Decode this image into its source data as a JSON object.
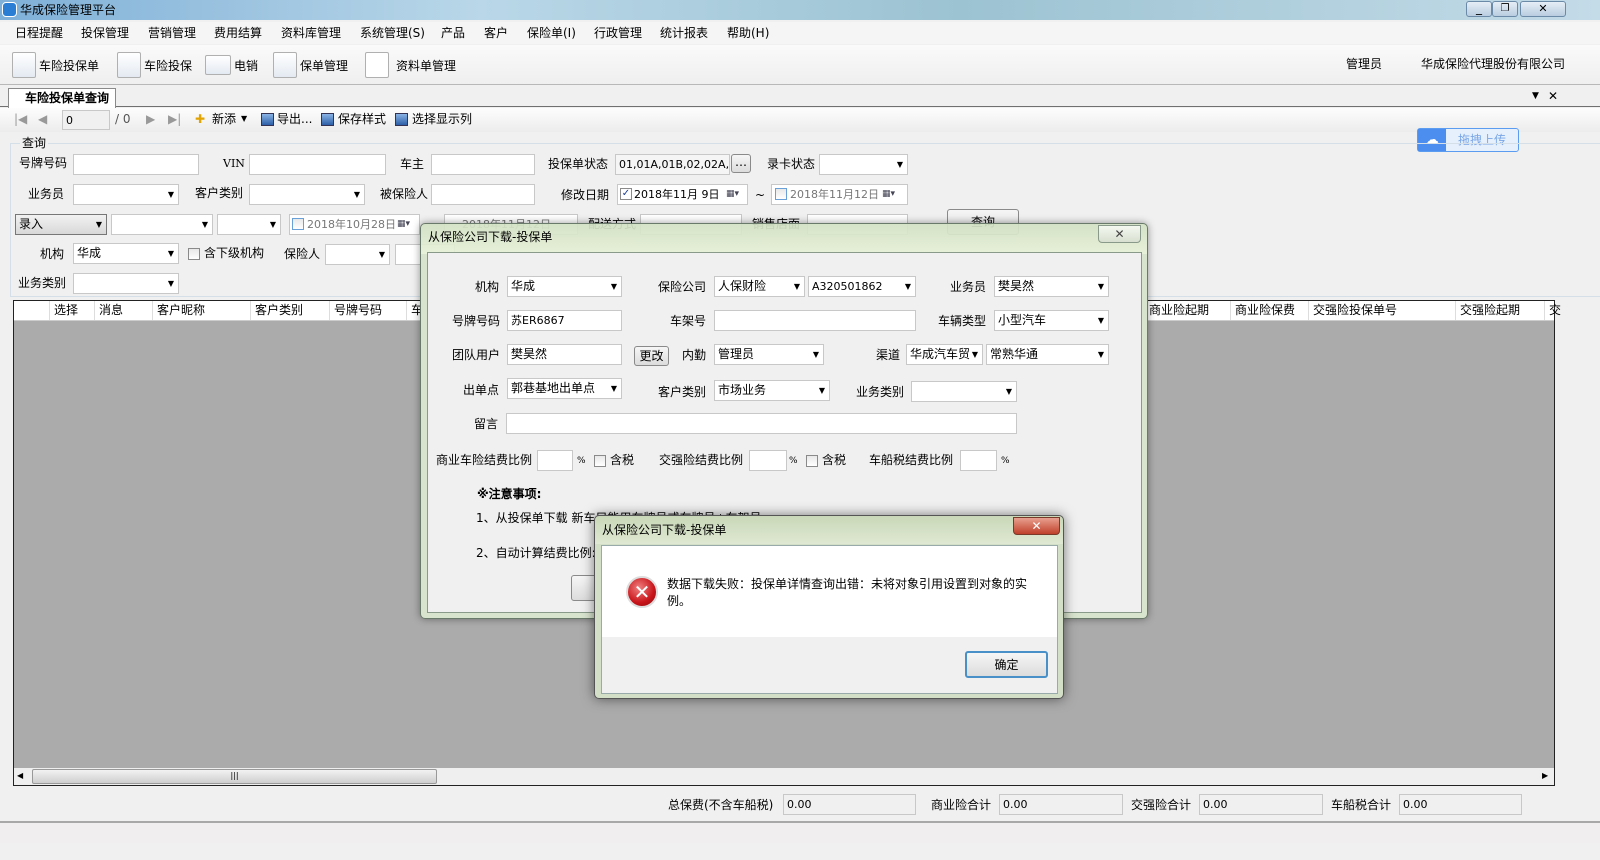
{
  "window": {
    "title": "华成保险管理平台",
    "icon": "app-car-icon"
  },
  "menu": [
    "日程提醒",
    "投保管理",
    "营销管理",
    "费用结算",
    "资料库管理",
    "系统管理(S)",
    "产品",
    "客户",
    "保险单(I)",
    "行政管理",
    "统计报表",
    "帮助(H)"
  ],
  "toolbar": {
    "buttons": [
      "车险投保单",
      "车险投保",
      "电销",
      "保单管理",
      "资料单管理"
    ],
    "user": "管理员",
    "company": "华成保险代理股份有限公司"
  },
  "tab": {
    "label": "车险投保单查询"
  },
  "nav": {
    "page": "0",
    "total": "/ 0",
    "add": "新添",
    "export": "导出...",
    "save_style": "保存样式",
    "select_columns": "选择显示列"
  },
  "upload": {
    "label": "拖拽上传"
  },
  "query": {
    "group": "查询",
    "plate_label": "号牌号码",
    "vin_label": "VIN",
    "owner_label": "车主",
    "status_label": "投保单状态",
    "status_value": "01,01A,01B,02,02A,0",
    "card_status_label": "录卡状态",
    "salesman_label": "业务员",
    "customer_type_label": "客户类别",
    "insured_label": "被保险人",
    "modified_label": "修改日期",
    "date_from": "2018年11月 9日",
    "tilde": "~",
    "date_to": "2018年11月12日",
    "entry_value": "录入",
    "date3": "2018年10月28日",
    "date4": "2018年11月12日",
    "delivery_label": "配送方式",
    "store_label": "销售店面",
    "query_button": "查询",
    "org_label": "机构",
    "org_value": "华成",
    "sub_org_label": "含下级机构",
    "insurer_label": "保险人",
    "biz_type_label": "业务类别"
  },
  "grid": {
    "columns": [
      "选择",
      "消息",
      "客户昵称",
      "客户类别",
      "号牌号码",
      "车",
      "商业险起期",
      "商业险保费",
      "交强险投保单号",
      "交强险起期",
      "交"
    ]
  },
  "totals": {
    "total_label": "总保费(不含车船税)",
    "total": "0.00",
    "commercial_label": "商业险合计",
    "commercial": "0.00",
    "compulsory_label": "交强险合计",
    "compulsory": "0.00",
    "vessel_label": "车船税合计",
    "vessel": "0.00"
  },
  "dialog": {
    "title": "从保险公司下载-投保单",
    "org_label": "机构",
    "org": "华成",
    "company_label": "保险公司",
    "company": "人保财险",
    "company_code": "A320501862",
    "salesman_label": "业务员",
    "salesman": "樊昊然",
    "plate_label": "号牌号码",
    "plate": "苏ER6867",
    "frame_label": "车架号",
    "frame": "",
    "vehicle_type_label": "车辆类型",
    "vehicle_type": "小型汽车",
    "team_label": "团队用户",
    "team": "樊昊然",
    "change_button": "更改",
    "clerk_label": "内勤",
    "clerk": "管理员",
    "channel_label": "渠道",
    "channel1": "华成汽车贸",
    "channel2": "常熟华通",
    "outlet_label": "出单点",
    "outlet": "郭巷基地出单点",
    "customer_type_label": "客户类别",
    "customer_type": "市场业务",
    "biz_type_label": "业务类别",
    "message_label": "留言",
    "comm_ratio_label": "商业车险结费比例",
    "pct": "%",
    "tax_label": "含税",
    "comp_ratio_label": "交强险结费比例",
    "vessel_ratio_label": "车船税结费比例",
    "notes_title": "※注意事项:",
    "note1": "1、从投保单下载 新车只能用车牌号或车牌号+车架号",
    "note2": "2、自动计算结费比例:"
  },
  "msgbox": {
    "title": "从保险公司下载-投保单",
    "message": "数据下载失败：投保单详情查询出错：未将对象引用设置到对象的实例。",
    "ok": "确定",
    "icon": "error-icon"
  }
}
